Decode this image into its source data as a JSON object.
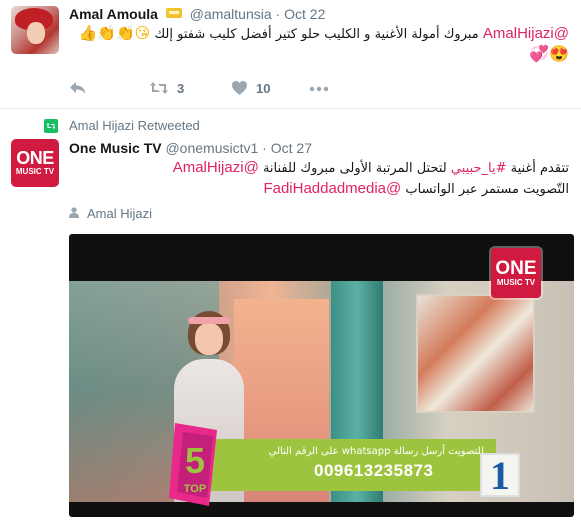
{
  "tweet1": {
    "name": "Amal Amoula",
    "badge_icon": "crown-badge-icon",
    "handle": "@amaltunsia",
    "separator": "·",
    "date": "Oct 22",
    "text_arabic": "مبروك أمولة الأغنية و الكليب حلو كتير أفضل كليب شفتو إلك",
    "mention": "@AmalHijazi",
    "emojis": "😘👏👏👍",
    "emojis_line2": "💞😍",
    "actions": {
      "reply_icon": "reply-icon",
      "retweet_icon": "retweet-icon",
      "retweet_count": "3",
      "like_icon": "heart-icon",
      "like_count": "10",
      "more_icon": "more-icon"
    }
  },
  "tweet2": {
    "retweeted_by": "Amal Hijazi Retweeted",
    "name": "One Music TV",
    "handle": "@onemusictv1",
    "separator": "·",
    "date": "Oct 27",
    "text_arabic_1": "تتقدم أغنية ",
    "hashtag": "#يا_حبيبي",
    "text_arabic_2": " لتحتل المرتبة الأولى مبروك للفنانة ",
    "mention1": "@AmalHijazi",
    "text_arabic_3": "التّصويت مستمر عبر الواتساب ",
    "mention2": "@FadiHaddadmedia",
    "tagged_person": "Amal Hijazi",
    "avatar_text": {
      "one": "ONE",
      "music": "MUSIC TV"
    },
    "media": {
      "logo_one": "ONE",
      "logo_music": "MUSIC TV",
      "banner_text": "للتصويت أرسل رسالة whatsapp على الرقم التالي",
      "phone": "009613235873",
      "top_label": "TOP",
      "top_number": "5",
      "rank": "1"
    }
  },
  "colors": {
    "mention": "#e0245e",
    "mention_blue": "#1b95e0",
    "muted": "#657786",
    "retweet_green": "#17bf63",
    "brand_red": "#d01a3f",
    "banner_green": "#9dc43f"
  }
}
